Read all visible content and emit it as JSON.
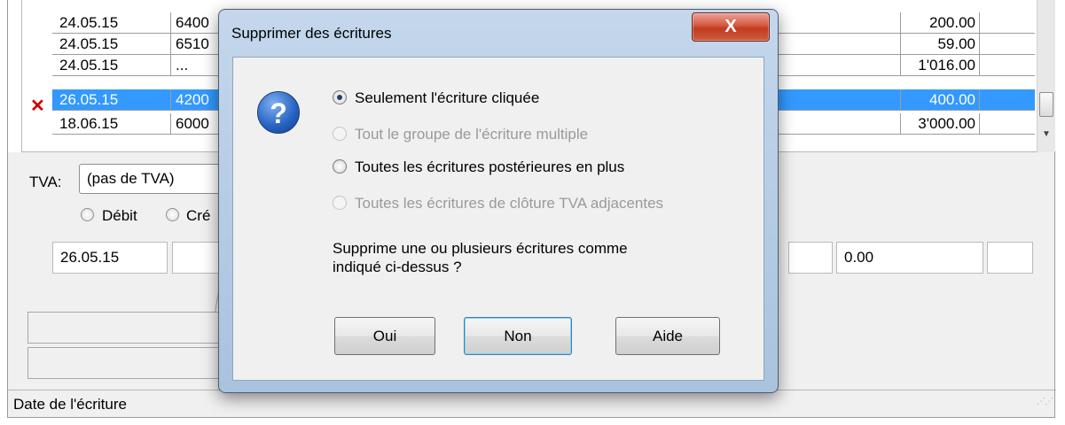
{
  "grid": {
    "rows": [
      {
        "date": "24.05.15",
        "account": "6400",
        "amount": "200.00",
        "selected": false
      },
      {
        "date": "24.05.15",
        "account": "6510",
        "amount": "59.00",
        "selected": false
      },
      {
        "date": "24.05.15",
        "account": "...",
        "amount": "1'016.00",
        "selected": false
      },
      {
        "date": "26.05.15",
        "account": "4200",
        "amount": "400.00",
        "selected": true
      },
      {
        "date": "18.06.15",
        "account": "6000",
        "amount": "3'000.00",
        "selected": false
      }
    ],
    "delete_marker": "✕"
  },
  "form": {
    "tva_label": "TVA:",
    "tva_value": "(pas de TVA)",
    "debit_label": "Débit",
    "credit_label": "Cré",
    "date_value": "26.05.15",
    "amount_value": "0.00"
  },
  "status_bar": {
    "text": "Date de l'écriture"
  },
  "dialog": {
    "title": "Supprimer des écritures",
    "close_glyph": "X",
    "icon": "question-icon",
    "icon_glyph": "?",
    "options": [
      {
        "label": "Seulement l'écriture cliquée",
        "checked": true,
        "enabled": true
      },
      {
        "label": "Tout le groupe de l'écriture multiple",
        "checked": false,
        "enabled": false
      },
      {
        "label": "Toutes les écritures postérieures en plus",
        "checked": false,
        "enabled": true
      },
      {
        "label": "Toutes les écritures de clôture TVA adjacentes",
        "checked": false,
        "enabled": false
      }
    ],
    "prompt_line1": "Supprime une ou plusieurs écritures comme",
    "prompt_line2": "indiqué ci-dessus ?",
    "buttons": {
      "yes": "Oui",
      "no": "Non",
      "help": "Aide"
    }
  },
  "colors": {
    "selection": "#3399ff",
    "close_button": "#c94a31",
    "title_bar": "#b7cde6"
  }
}
